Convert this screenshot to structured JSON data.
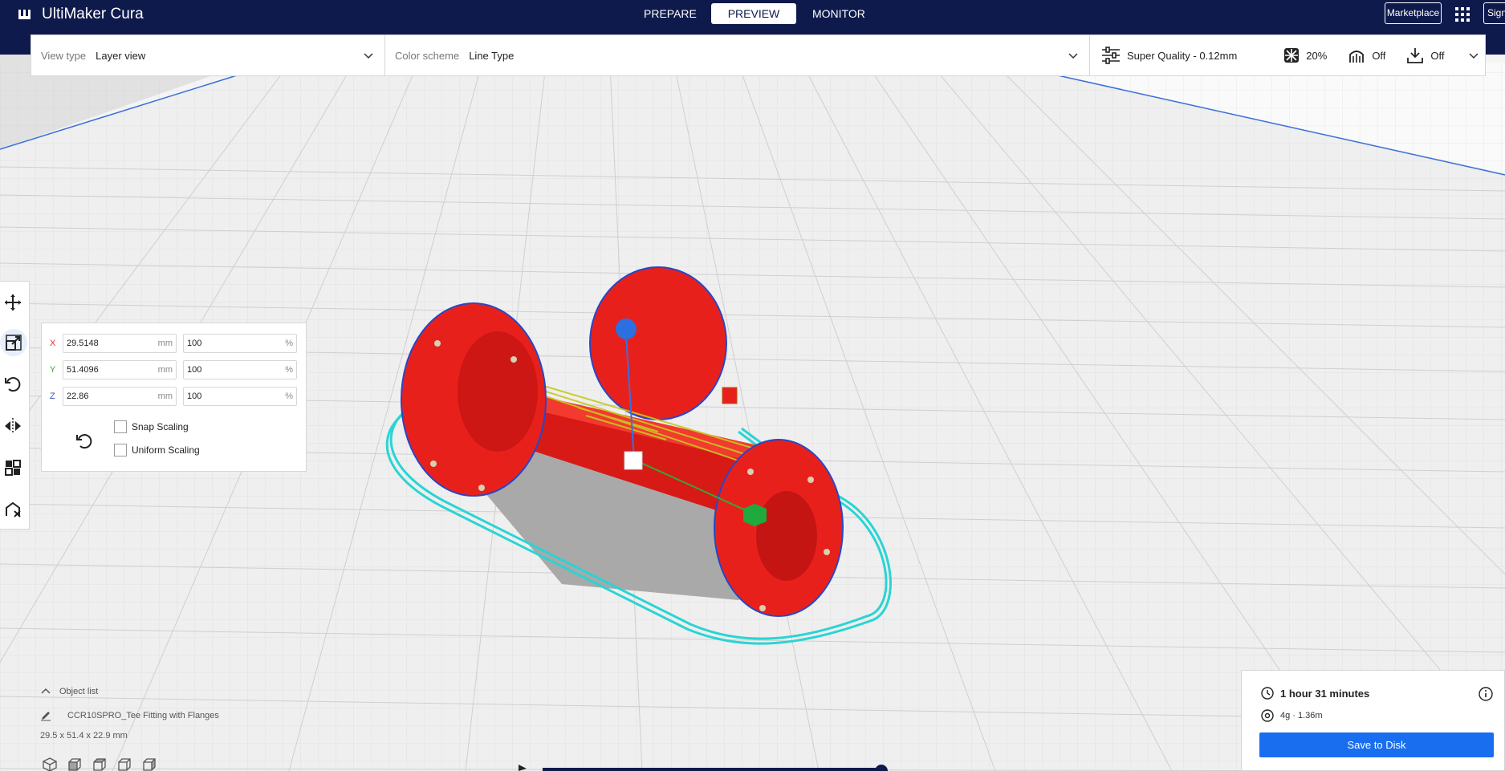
{
  "app": {
    "name": "UltiMaker Cura"
  },
  "stages": [
    {
      "label": "PREPARE",
      "active": false
    },
    {
      "label": "PREVIEW",
      "active": true
    },
    {
      "label": "MONITOR",
      "active": false
    }
  ],
  "topbar_right": {
    "marketplace": "Marketplace",
    "sign_in": "Sign"
  },
  "view_type": {
    "label": "View type",
    "value": "Layer view"
  },
  "color_scheme": {
    "label": "Color scheme",
    "value": "Line Type"
  },
  "print_setup": {
    "profile": "Super Quality - 0.12mm",
    "infill": "20%",
    "support": "Off",
    "adhesion": "Off"
  },
  "tools": [
    "move-tool",
    "scale-tool",
    "rotate-tool",
    "mirror-tool",
    "per-model-settings-tool",
    "support-blocker-tool"
  ],
  "scale": {
    "x": {
      "axis": "X",
      "mm": "29.5148",
      "mm_unit": "mm",
      "pct": "100",
      "pct_unit": "%"
    },
    "y": {
      "axis": "Y",
      "mm": "51.4096",
      "mm_unit": "mm",
      "pct": "100",
      "pct_unit": "%"
    },
    "z": {
      "axis": "Z",
      "mm": "22.86",
      "mm_unit": "mm",
      "pct": "100",
      "pct_unit": "%"
    },
    "snap_scaling": "Snap Scaling",
    "uniform_scaling": "Uniform Scaling"
  },
  "object_list": {
    "title": "Object list",
    "item": "CCR10SPRO_Tee Fitting with Flanges",
    "dims": "29.5 x 51.4 x 22.9 mm"
  },
  "print_info": {
    "time": "1 hour 31 minutes",
    "material": "4g · 1.36m",
    "save": "Save to Disk"
  },
  "colors": {
    "topbar": "#0f1a4c",
    "accent": "#196ef0",
    "model": "#e8201c",
    "skirt": "#2ad4d4"
  }
}
